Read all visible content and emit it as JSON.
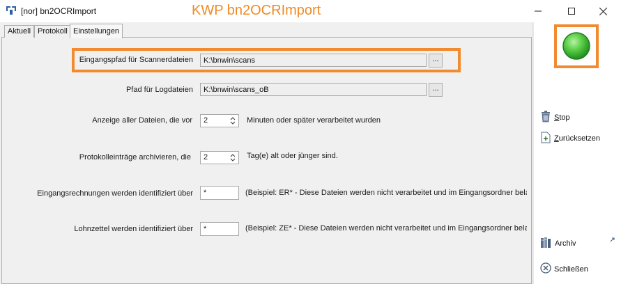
{
  "window": {
    "title": "[nor] bn2OCRImport",
    "overlay_title": "KWP bn2OCRImport",
    "controls": {
      "minimize": "—",
      "maximize": "☐",
      "close": "✕"
    }
  },
  "tabs": [
    {
      "label": "Aktuell",
      "active": false
    },
    {
      "label": "Protokoll",
      "active": false
    },
    {
      "label": "Einstellungen",
      "active": true
    }
  ],
  "settings": {
    "scanner_path": {
      "label": "Eingangspfad für Scannerdateien",
      "value": "K:\\bnwin\\scans",
      "browse": "..."
    },
    "log_path": {
      "label": "Pfad für Logdateien",
      "value": "K:\\bnwin\\scans_oB",
      "browse": "..."
    },
    "show_files": {
      "label": "Anzeige aller Dateien, die vor",
      "value": "2",
      "suffix": "Minuten  oder später verarbeitet wurden"
    },
    "archive_log": {
      "label": "Protokolleinträge archivieren, die",
      "value": "2",
      "suffix": "Tag(e) alt oder jünger sind."
    },
    "invoices": {
      "label": "Eingangsrechnungen werden identifiziert über",
      "value": "*",
      "hint": "(Beispiel: ER*  -  Diese Dateien werden nicht verarbeitet und im Eingangsordner belas"
    },
    "payslips": {
      "label": "Lohnzettel werden identifiziert über",
      "value": "*",
      "hint": "(Beispiel: ZE*  -  Diese Dateien werden nicht verarbeitet und im Eingangsordner belass"
    }
  },
  "sidebar": {
    "status": "running",
    "status_color": "#34c034",
    "accent_color": "#f28b30",
    "stop": {
      "hotkey": "S",
      "rest": "top"
    },
    "reset": {
      "hotkey": "Z",
      "rest": "urücksetzen"
    },
    "archive": {
      "label": "Archiv"
    },
    "close": {
      "label": "Schließen"
    }
  }
}
